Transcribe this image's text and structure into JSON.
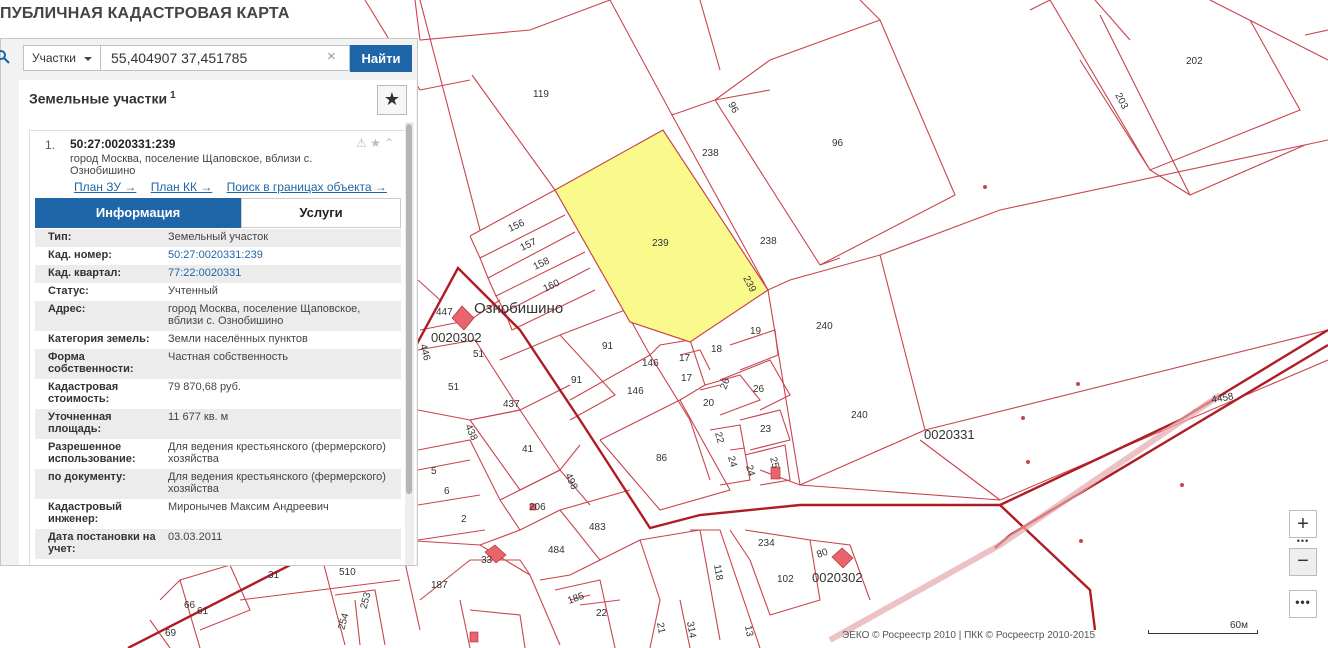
{
  "app": {
    "title": "ПУБЛИЧНАЯ КАДАСТРОВАЯ КАРТА"
  },
  "search": {
    "layer_selected": "Участки",
    "query": "55,404907 37,451785",
    "clear": "×",
    "button_label": "Найти"
  },
  "results": {
    "title": "Земельные участки",
    "count": "1",
    "fav_icon": "★"
  },
  "card": {
    "index": "1.",
    "number": "50:27:0020331:239",
    "address": "город Москва, поселение Щаповское, вблизи с. Ознобишино",
    "icons": "⚠ ★ ⌃",
    "links": [
      "План ЗУ →",
      "План КК →",
      "Поиск в границах объекта →"
    ],
    "tabs": {
      "info": "Информация",
      "services": "Услуги"
    },
    "rows": [
      {
        "k": "Тип:",
        "v": "Земельный участок"
      },
      {
        "k": "Кад. номер:",
        "v": "50:27:0020331:239"
      },
      {
        "k": "Кад. квартал:",
        "v": "77:22:0020331"
      },
      {
        "k": "Статус:",
        "v": "Учтенный"
      },
      {
        "k": "Адрес:",
        "v": "город Москва, поселение Щаповское, вблизи с. Ознобишино"
      },
      {
        "k": "Категория земель:",
        "v": "Земли населённых пунктов"
      },
      {
        "k": "Форма собственности:",
        "v": "Частная собственность"
      },
      {
        "k": "Кадастровая стоимость:",
        "v": "79 870,68 руб."
      },
      {
        "k": "Уточненная площадь:",
        "v": "11 677 кв. м"
      },
      {
        "k": "Разрешенное использование:",
        "v": "Для ведения крестьянского (фермерского) хозяйства"
      },
      {
        "k": "по документу:",
        "v": "Для ведения крестьянского (фермерского) хозяйства"
      },
      {
        "k": "Кадастровый инженер:",
        "v": "Миронычев Максим Андреевич"
      },
      {
        "k": "Дата постановки на учет:",
        "v": "03.03.2011"
      }
    ]
  },
  "map": {
    "colors": {
      "parcel": "#c9444c",
      "road": "#b01c24",
      "selected": "#fafa8c",
      "building": "#e9646b"
    },
    "locality": "Ознобишино",
    "quarter_labels": [
      "0020302",
      "0020331",
      "0020302"
    ],
    "parcel_labels": [
      "119",
      "202",
      "203",
      "96",
      "96",
      "238",
      "238",
      "239",
      "239",
      "156",
      "157",
      "158",
      "160",
      "447",
      "446",
      "51",
      "51",
      "91",
      "91",
      "146",
      "146",
      "17",
      "17",
      "18",
      "19",
      "240",
      "240",
      "26",
      "26",
      "20",
      "437",
      "438",
      "41",
      "5",
      "6",
      "2",
      "206",
      "498",
      "483",
      "484",
      "22",
      "24",
      "23",
      "25",
      "24",
      "86",
      "234",
      "80",
      "102",
      "118",
      "187",
      "33",
      "31",
      "510",
      "253",
      "254",
      "66",
      "61",
      "69",
      "185",
      "22",
      "21",
      "314",
      "13",
      "4458"
    ],
    "controls": {
      "zoom_in": "+",
      "zoom_out": "−",
      "dots": "•••",
      "more": "•••"
    },
    "copyright": "ЭЕКО © Росреестр 2010 | ПКК © Росреестр 2010-2015",
    "scale": "60м"
  }
}
